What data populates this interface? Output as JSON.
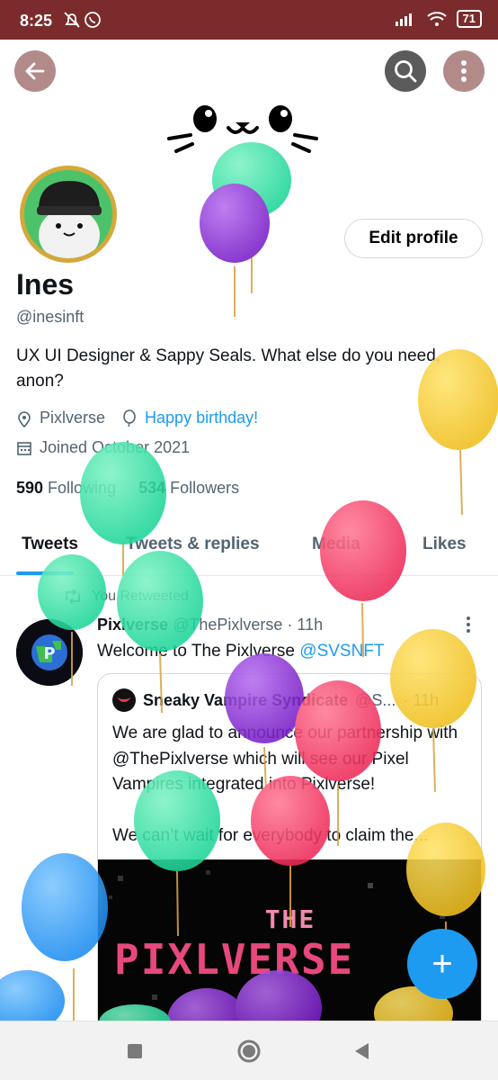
{
  "status_bar": {
    "time": "8:25",
    "battery": "71"
  },
  "header": {
    "back_icon": "arrow-left-icon",
    "search_icon": "search-icon",
    "more_icon": "more-vertical-icon"
  },
  "profile": {
    "name": "Ines",
    "handle": "@inesinft",
    "edit_label": "Edit profile",
    "bio": "UX UI Designer & Sappy Seals. What else do you need, anon?",
    "location": "Pixlverse",
    "birthday": "Happy birthday!",
    "joined": "Joined October 2021",
    "following_count": "590",
    "following_label": " Following",
    "followers_count": "534",
    "followers_label": " Followers"
  },
  "tabs": [
    {
      "label": "Tweets"
    },
    {
      "label": "Tweets & replies"
    },
    {
      "label": "Media"
    },
    {
      "label": "Likes"
    }
  ],
  "tweet": {
    "retweet_label": "You Retweeted",
    "author": "Pixlverse",
    "author_handle": "@ThePixlverse",
    "time": "· 11h",
    "text": "Welcome to The Pixlverse ",
    "mention": "@SVSNFT",
    "quote": {
      "author": "Sneaky Vampire Syndicate",
      "handle": "@S...",
      "time": "· 11h",
      "text_line1": "We are glad to announce our partnership with @ThePixlverse which will see our Pixel Vampires integrated into Pixlverse!",
      "text_line2": "We can’t wait for everybody to claim the...",
      "image_title1": "THE",
      "image_title2": "PIXLVERSE"
    }
  },
  "fab": {
    "label": "+"
  },
  "colors": {
    "status_bar": "#7b2b2b",
    "accent": "#1d9bf0",
    "text": "#0f1419",
    "muted": "#536471"
  }
}
